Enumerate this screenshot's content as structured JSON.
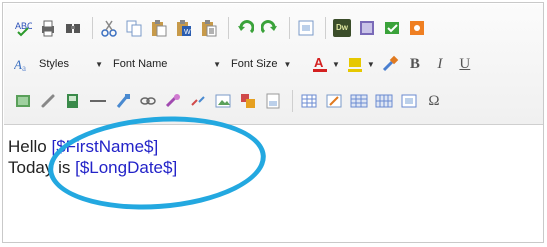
{
  "toolbar": {
    "row1_icons": [
      "spellcheck-icon",
      "print-icon",
      "find-icon",
      "cut-icon",
      "copy-icon",
      "paste-icon",
      "paste-word-icon",
      "paste-text-icon",
      "undo-icon",
      "redo-icon",
      "preview-icon",
      "dreamweaver-icon",
      "template-icon",
      "save-icon",
      "settings-icon"
    ],
    "styles_label": "Styles",
    "font_name_label": "Font Name",
    "font_size_label": "Font Size",
    "dw_label": "Dw",
    "bold_label": "B",
    "italic_label": "I",
    "underline_label": "U",
    "omega_label": "Ω"
  },
  "editor": {
    "line1_prefix": "Hello ",
    "line1_token": "[$FirstName$]",
    "line2_prefix": "Today is ",
    "line2_token": "[$LongDate$]"
  },
  "colors": {
    "token": "#2323c8",
    "highlight": "#23a8e0",
    "font_color_a": "#d42020",
    "highlight_color": "#e6c800"
  }
}
